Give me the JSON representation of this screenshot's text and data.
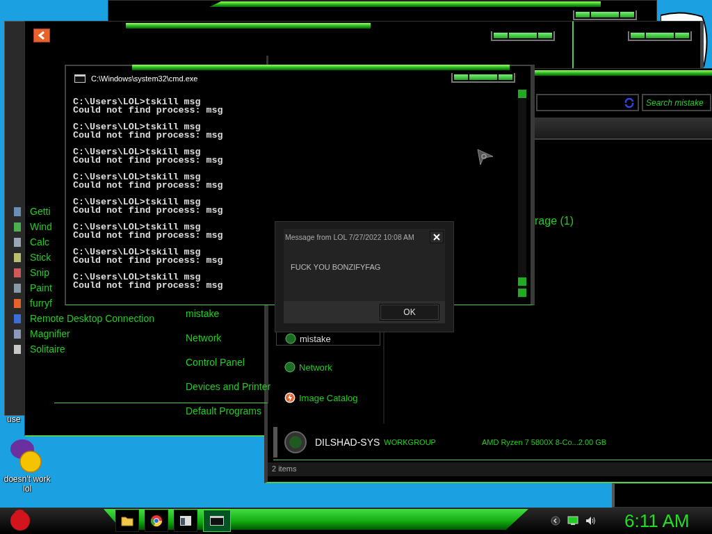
{
  "desktop": {
    "icons": [
      {
        "label": "use",
        "kind": "cut"
      },
      {
        "label": "doesn't work lol",
        "kind": "messenger"
      }
    ]
  },
  "start_menu": {
    "programs": [
      {
        "label": "Getti",
        "color": "#6a8fb5"
      },
      {
        "label": "Wind",
        "color": "#4caf50"
      },
      {
        "label": "Calc",
        "color": "#9aa7b8"
      },
      {
        "label": "Stick",
        "color": "#b8c070"
      },
      {
        "label": "Snip",
        "color": "#d05a5a"
      },
      {
        "label": "Paint",
        "color": "#8899aa"
      },
      {
        "label": "furryf",
        "color": "#e8632a"
      },
      {
        "label": "Remote Desktop Connection",
        "color": "#3a6fd8"
      },
      {
        "label": "Magnifier",
        "color": "#8a9ab8"
      },
      {
        "label": "Solitaire",
        "color": "#c8c8c8"
      }
    ],
    "places": [
      "mistake",
      "Network",
      "Control Panel",
      "Devices and Printer",
      "Default Programs"
    ]
  },
  "cmd": {
    "title": "C:\\Windows\\system32\\cmd.exe",
    "entries": [
      {
        "command": "C:\\Users\\LOL>tskill msg",
        "output": "Could not find process: msg"
      },
      {
        "command": "C:\\Users\\LOL>tskill msg",
        "output": "Could not find process: msg"
      },
      {
        "command": "C:\\Users\\LOL>tskill msg",
        "output": "Could not find process: msg"
      },
      {
        "command": "C:\\Users\\LOL>tskill msg",
        "output": "Could not find process: msg"
      },
      {
        "command": "C:\\Users\\LOL>tskill msg",
        "output": "Could not find process: msg"
      },
      {
        "command": "C:\\Users\\LOL>tskill msg",
        "output": "Could not find process: msg"
      },
      {
        "command": "C:\\Users\\LOL>tskill msg",
        "output": "Could not find process: msg"
      },
      {
        "command": "C:\\Users\\LOL>tskill msg",
        "output": "Could not find process: msg"
      }
    ]
  },
  "explorer": {
    "search": {
      "placeholder": "Search mistake"
    },
    "heading": "rage (1)",
    "nav": [
      {
        "label": "mistake",
        "selected": true,
        "kind": "homegroup"
      },
      {
        "label": "Network",
        "selected": false,
        "kind": "network"
      },
      {
        "label": "Image Catalog",
        "selected": false,
        "kind": "catalog"
      }
    ],
    "details": {
      "name": "DILSHAD-SYS",
      "workgroup": "WORKGROUP",
      "processor": "AMD Ryzen 7 5800X 8-Co...2.00 GB"
    },
    "status_bar": "2 items"
  },
  "dialog": {
    "title": "Message from LOL 7/27/2022 10:08 AM",
    "message": "FUCK YOU BONZIFYFAG",
    "buttons": [
      "OK"
    ]
  },
  "taskbar": {
    "apps": [
      {
        "kind": "folder",
        "active": false
      },
      {
        "kind": "browser",
        "active": false
      },
      {
        "kind": "window",
        "active": false
      },
      {
        "kind": "console",
        "active": true
      }
    ],
    "clock": "6:11 AM"
  }
}
